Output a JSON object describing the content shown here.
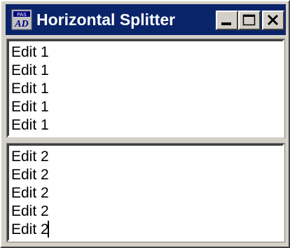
{
  "window": {
    "title": "Horizontal Splitter"
  },
  "title_buttons": {
    "minimize": "minimize-icon",
    "maximize": "maximize-icon",
    "close": "close-icon"
  },
  "colors": {
    "titlebar": "#0a246a",
    "face": "#d4d0c8",
    "edit_background": "#ffffff"
  },
  "top_edit": {
    "lines": [
      "Edit 1",
      "Edit 1",
      "Edit 1",
      "Edit 1",
      "Edit 1"
    ]
  },
  "bottom_edit": {
    "lines": [
      "Edit 2",
      "Edit 2",
      "Edit 2",
      "Edit 2",
      "Edit 2"
    ]
  }
}
